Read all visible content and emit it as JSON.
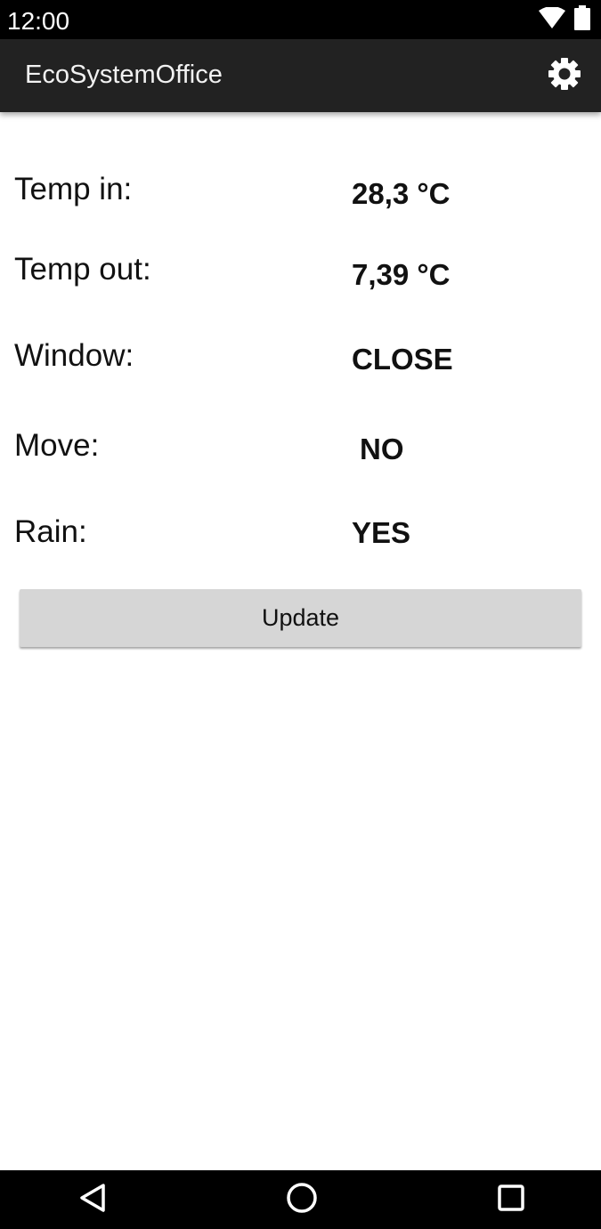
{
  "status_bar": {
    "time": "12:00",
    "icons": [
      "wifi-icon",
      "battery-icon"
    ]
  },
  "app_bar": {
    "title": "EcoSystemOffice",
    "settings_icon": "gear-icon",
    "background": "#222222"
  },
  "readings": [
    {
      "label": "Temp in:",
      "value": "28,3 °C"
    },
    {
      "label": "Temp out:",
      "value": "7,39 °C"
    },
    {
      "label": "Window:",
      "value": "CLOSE"
    },
    {
      "label": "Move:",
      "value": "NO"
    },
    {
      "label": "Rain:",
      "value": "YES"
    }
  ],
  "update_button": {
    "label": "Update",
    "background": "#d6d6d6"
  },
  "nav_bar": {
    "buttons": [
      "back-icon",
      "home-icon",
      "recents-icon"
    ]
  }
}
